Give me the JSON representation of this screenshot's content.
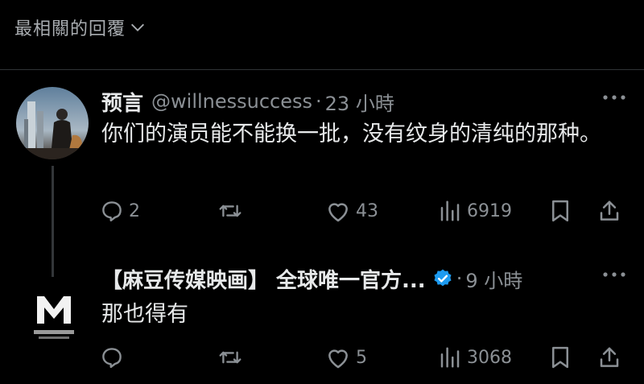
{
  "sort": {
    "label": "最相關的回覆"
  },
  "replies": [
    {
      "name": "预言",
      "handle": "@willnessuccess",
      "time": "23 小時",
      "text": "你们的演员能不能换一批，没有纹身的清纯的那种。",
      "stats": {
        "replies": "2",
        "reposts": "",
        "likes": "43",
        "views": "6919"
      }
    },
    {
      "name": "【麻豆传媒映画】 全球唯一官方...",
      "verified": true,
      "time": "9 小時",
      "text": "那也得有",
      "stats": {
        "replies": "",
        "reposts": "",
        "likes": "5",
        "views": "3068"
      }
    }
  ],
  "colors": {
    "background": "#000000",
    "text": "#e7e9ea",
    "muted": "#8b9095",
    "verified": "#1d9bf0"
  }
}
